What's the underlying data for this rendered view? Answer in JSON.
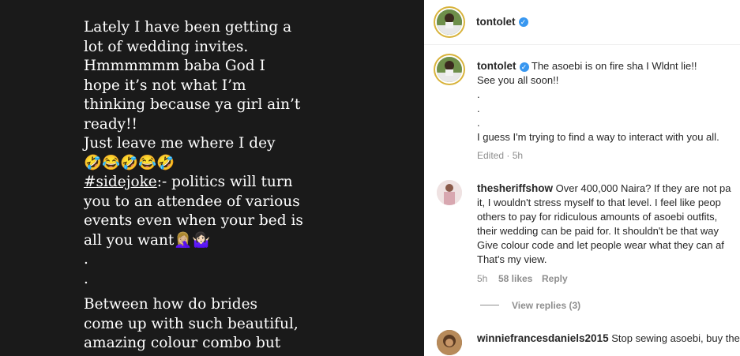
{
  "post": {
    "caption_lines": [
      "Lately I have been getting a",
      "lot of wedding invites.",
      "Hmmmmmm baba God I",
      "hope it’s not what I’m",
      "thinking because ya girl ain’t",
      "ready!!",
      "Just leave me where I dey",
      "🤣😂🤣😂🤣"
    ],
    "hashtag": "#sidejoke",
    "hashtag_rest": ":- politics will turn",
    "caption_lines_2": [
      "you to an attendee of various",
      "events even when your bed is"
    ],
    "last_line_text": "all you want",
    "last_line_emoji": "🤦🏼‍♀️🤷🏻‍♀️",
    "dots": [
      ".",
      "."
    ],
    "caption_lines_3": [
      "Between how do brides",
      "come up with such beautiful,",
      "amazing colour combo but",
      "...."
    ]
  },
  "header": {
    "username": "tontolet",
    "verified_icon": "verified-badge-icon"
  },
  "owner_comment": {
    "username": "tontolet",
    "text": "The asoebi is on fire sha I Wldnt lie!!",
    "lines": [
      "See you all soon!!",
      ".",
      ".",
      ".",
      "I guess I'm trying to find a way to interact with you all."
    ],
    "meta": "Edited · 5h"
  },
  "comments": [
    {
      "username": "thesheriffshow",
      "text": "Over 400,000 Naira? If they are not pa",
      "lines": [
        "it, I wouldn't stress myself to that level. I feel like peop",
        "others to pay for ridiculous amounts of asoebi outfits,",
        "their wedding can be paid for. It shouldn't be that way",
        "Give colour code and let people wear what they can af",
        "That's my view."
      ],
      "time": "5h",
      "likes": "58 likes",
      "reply": "Reply",
      "view_replies": "View replies (3)"
    },
    {
      "username": "winniefrancesdaniels2015",
      "text": "Stop sewing asoebi, buy the"
    }
  ],
  "colors": {
    "left_bg": "#1a1a1a",
    "verified": "#3897f0",
    "muted": "#8e8e8e"
  }
}
